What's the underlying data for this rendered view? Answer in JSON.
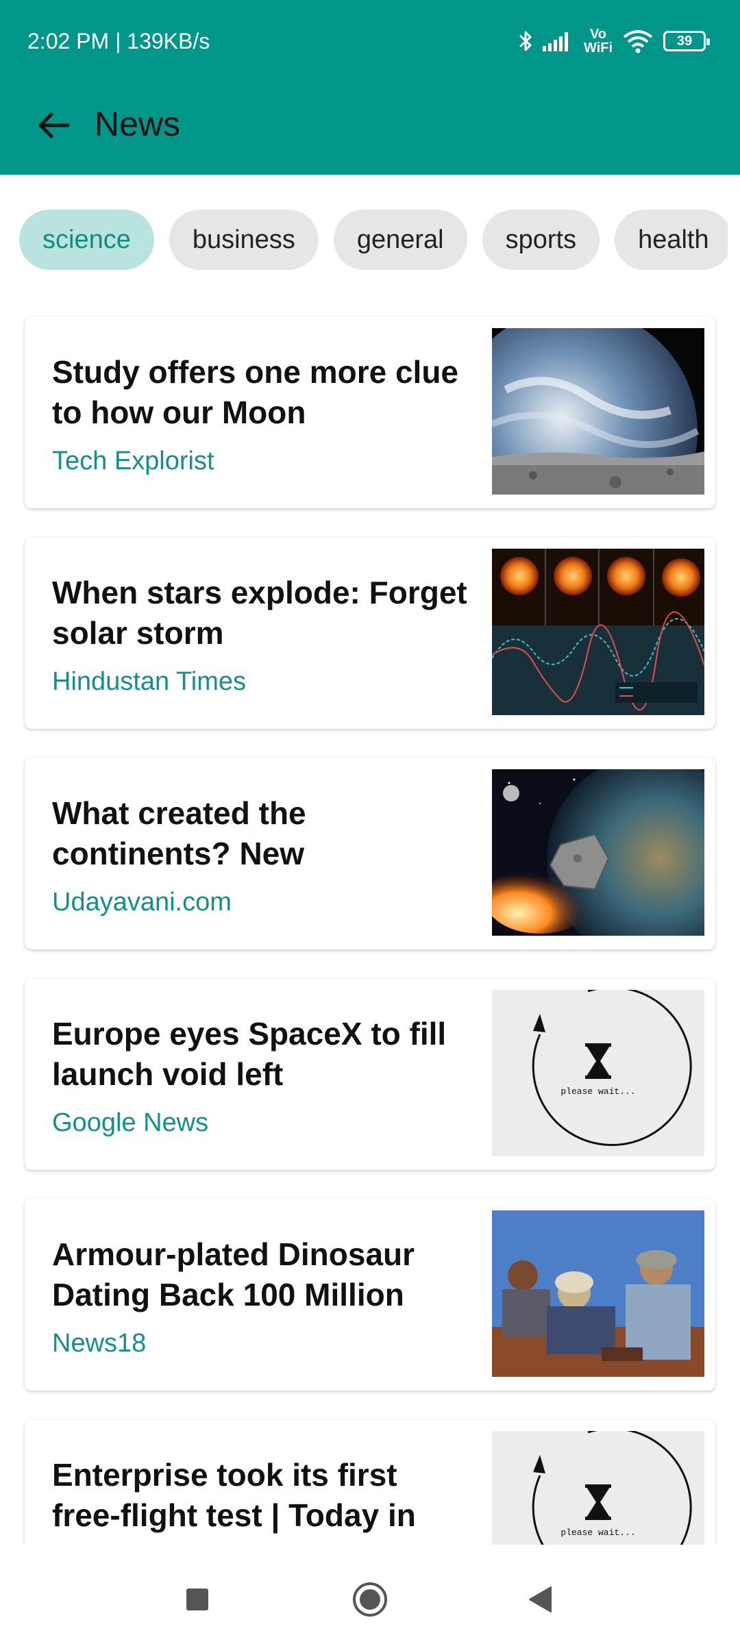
{
  "status_bar": {
    "time_speed": "2:02 PM | 139KB/s",
    "vowifi_top": "Vo",
    "vowifi_bottom": "WiFi",
    "battery": "39"
  },
  "app_bar": {
    "title": "News",
    "back_icon": "arrow-back-icon"
  },
  "colors": {
    "primary": "#00968a",
    "accent_text": "#119187",
    "chip_active_bg": "#b9e3df",
    "chip_bg": "#e6e6e6"
  },
  "categories": {
    "selected": "science",
    "items": [
      "science",
      "business",
      "general",
      "sports",
      "health"
    ]
  },
  "articles": [
    {
      "title": "Study offers one more clue to how our Moon",
      "source": "Tech Explorist",
      "image": "earth-moon-image"
    },
    {
      "title": "When stars explode: Forget solar storm",
      "source": "Hindustan Times",
      "image": "star-brightness-chart-image"
    },
    {
      "title": "What created the continents? New",
      "source": "Udayavani.com",
      "image": "asteroid-earth-image"
    },
    {
      "title": "Europe eyes SpaceX to fill launch void left",
      "source": "Google News",
      "image": "loading-placeholder-image",
      "image_text": "please wait..."
    },
    {
      "title": "Armour-plated Dinosaur Dating Back 100 Million",
      "source": "News18",
      "image": "scientists-dig-image"
    },
    {
      "title": "Enterprise took its first free-flight test | Today in",
      "source": "",
      "image": "loading-placeholder-image",
      "image_text": "please wait..."
    }
  ],
  "nav_bar": {
    "recents_icon": "square-icon",
    "home_icon": "circle-home-icon",
    "back_icon": "triangle-back-icon"
  }
}
